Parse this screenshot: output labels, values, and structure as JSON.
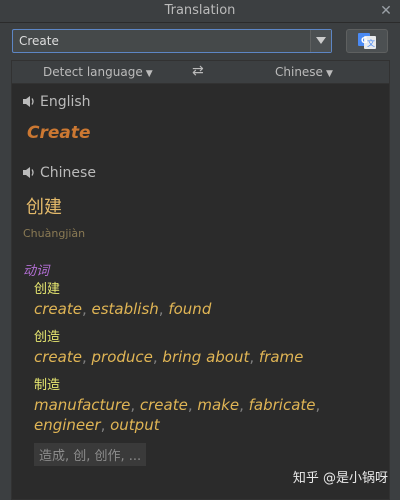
{
  "window": {
    "title": "Translation"
  },
  "search": {
    "value": "Create"
  },
  "lang_bar": {
    "source": "Detect language",
    "target": "Chinese"
  },
  "source": {
    "language": "English",
    "word": "Create"
  },
  "target": {
    "language": "Chinese",
    "word": "创建",
    "pinyin": "Chuàngjiàn"
  },
  "dictionary": {
    "pos": "动词",
    "entries": [
      {
        "term": "创建",
        "meanings": [
          "create",
          "establish",
          "found"
        ]
      },
      {
        "term": "创造",
        "meanings": [
          "create",
          "produce",
          "bring about",
          "frame"
        ]
      },
      {
        "term": "制造",
        "meanings": [
          "manufacture",
          "create",
          "make",
          "fabricate",
          "engineer",
          "output"
        ]
      }
    ],
    "more": "造成, 创, 创作, ..."
  },
  "watermark": "知乎 @是小锅呀",
  "colors": {
    "background": "#3c3f41",
    "panel": "#2b2b2b",
    "source_word": "#cc7832",
    "target_word": "#e3b96a",
    "pos": "#b46fd6",
    "entry_term": "#e8e870",
    "meaning": "#e0b555"
  }
}
